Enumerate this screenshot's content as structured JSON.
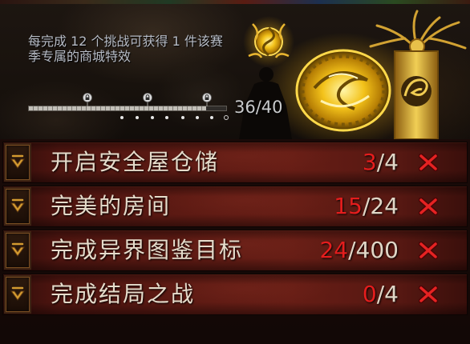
{
  "panel": {
    "reward_info": {
      "line1": "每完成 12 个挑战可获得 1 件该赛",
      "line2": "季专属的商城特效"
    },
    "progress": {
      "completed": 36,
      "total": 40,
      "label": "36/40",
      "milestones": [
        12,
        24,
        36
      ],
      "milestone_icon": "lock-icon"
    }
  },
  "challenges": [
    {
      "name": "开启安全屋仓储",
      "current": "3",
      "total_text": "/4",
      "expand_icon": "chevron-down-icon",
      "status_icon": "red-x-icon"
    },
    {
      "name": "完美的房间",
      "current": "15",
      "total_text": "/24",
      "expand_icon": "chevron-down-icon",
      "status_icon": "red-x-icon"
    },
    {
      "name": "完成异界图鉴目标",
      "current": "24",
      "total_text": "/400",
      "expand_icon": "chevron-down-icon",
      "status_icon": "red-x-icon"
    },
    {
      "name": "完成结局之战",
      "current": "0",
      "total_text": "/4",
      "expand_icon": "chevron-down-icon",
      "status_icon": "red-x-icon"
    }
  ],
  "colors": {
    "count_current": "#e41d1d",
    "count_total": "#e0d6c6",
    "challenge_name": "#e6dccb",
    "status_x": "#e52222",
    "reward_text": "#b7bcc6",
    "icon_gold": "#d39a30",
    "progress_label": "#c8cacc"
  }
}
